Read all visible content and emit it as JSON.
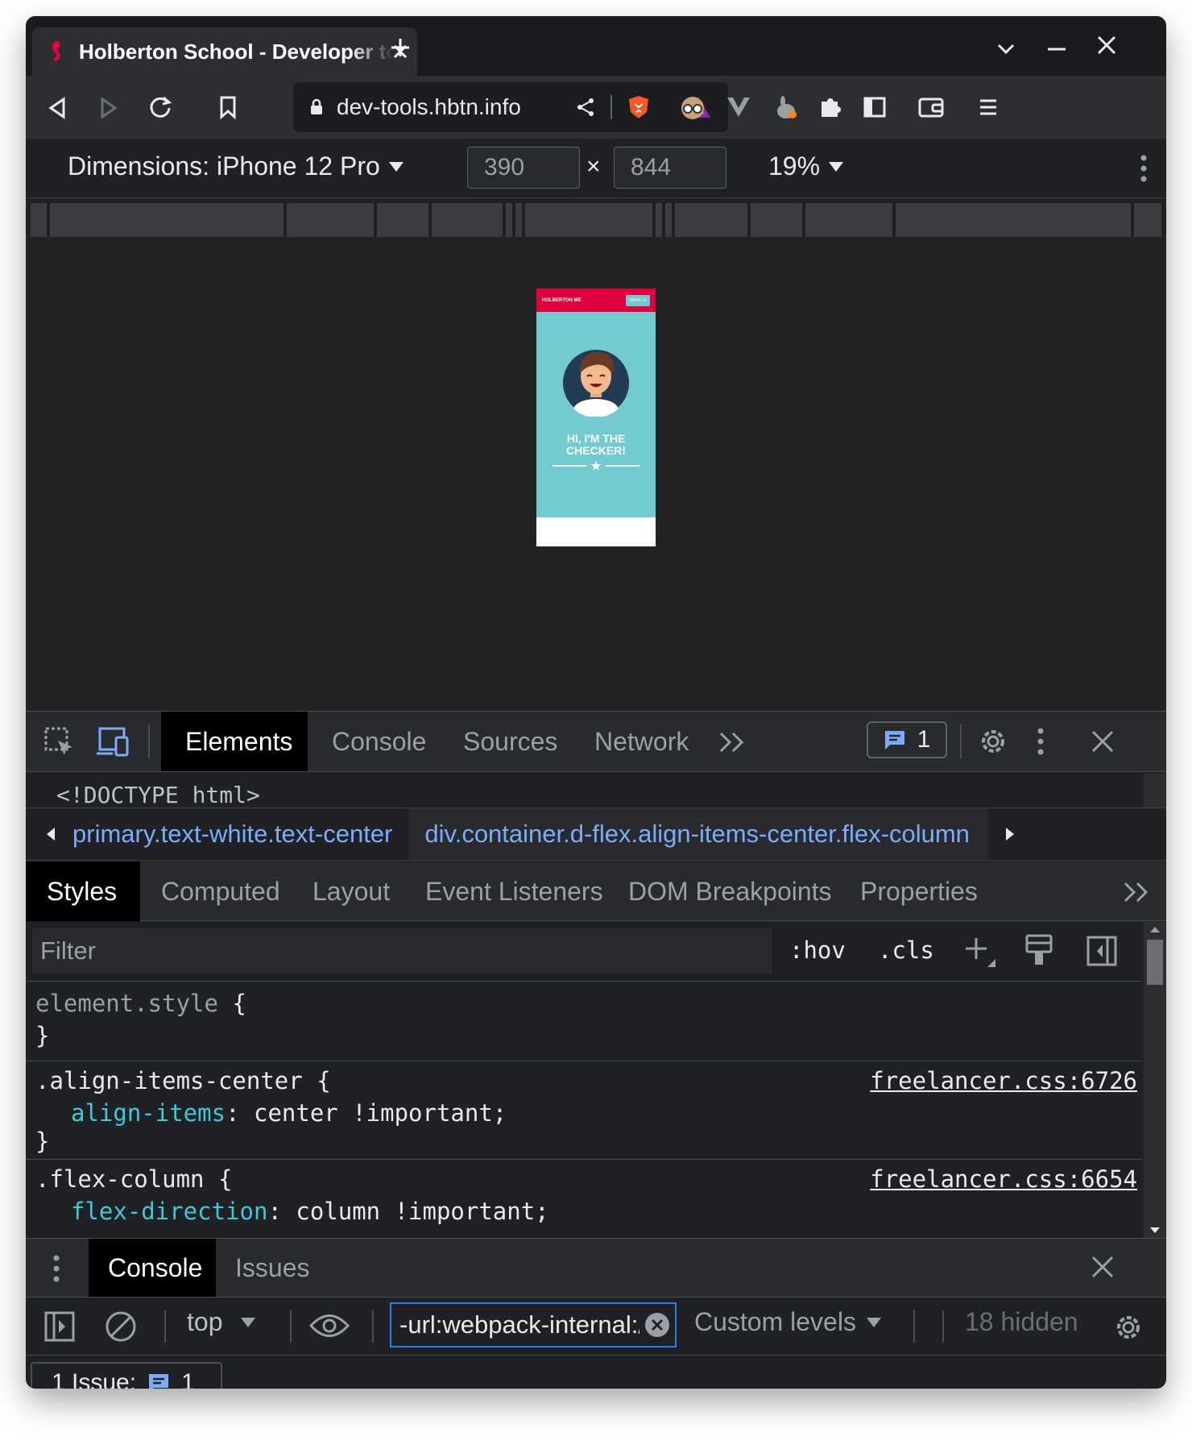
{
  "browser": {
    "tab_title": "Holberton School - Developer tools",
    "url": "dev-tools.hbtn.info"
  },
  "device_toolbar": {
    "dimensions_label": "Dimensions: iPhone 12 Pro",
    "width": "390",
    "times": "×",
    "height": "844",
    "zoom": "19%"
  },
  "phone_page": {
    "brand": "HOLBERTON ME",
    "menu": "MENU ☰",
    "headline": "HI, I'M THE CHECKER!"
  },
  "devtools": {
    "tabs": [
      "Elements",
      "Console",
      "Sources",
      "Network"
    ],
    "more": "»",
    "issues_count": "1",
    "doctype": "<!DOCTYPE html>",
    "breadcrumbs": [
      "primary.text-white.text-center",
      "div.container.d-flex.align-items-center.flex-column"
    ],
    "subtabs": [
      "Styles",
      "Computed",
      "Layout",
      "Event Listeners",
      "DOM Breakpoints",
      "Properties"
    ],
    "filter_placeholder": "Filter",
    "hov": ":hov",
    "cls": ".cls",
    "rules": {
      "r1_selector": "element.style",
      "open_brace": " {",
      "close_brace": "}",
      "r2_selector": ".align-items-center",
      "r2_source": "freelancer.css:6726",
      "r2_prop": "align-items",
      "r2_value": ": center !important;",
      "r3_selector": ".flex-column",
      "r3_source": "freelancer.css:6654",
      "r3_prop": "flex-direction",
      "r3_value": ": column !important;"
    }
  },
  "drawer": {
    "tabs": [
      "Console",
      "Issues"
    ],
    "context": "top",
    "filter_value": "-url:webpack-internal:///",
    "levels": "Custom levels",
    "hidden": "18 hidden",
    "issue_label": "1 Issue:",
    "issue_count": "1"
  },
  "colors": {
    "accent_blue": "#7cacf8",
    "phone_header": "#e2013f",
    "phone_body": "#72cbcf"
  }
}
